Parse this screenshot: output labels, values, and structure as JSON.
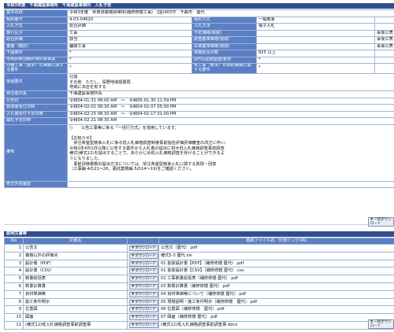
{
  "header": {
    "title": "令和3年度　千曲建設事務所　千曲建設事務所　入札予定"
  },
  "info": {
    "rows": [
      {
        "l1": "案件名称",
        "v1": "令和3年度　県単道路橋梁維持(補修修繕工事)　(国)403号　千曲市　屋代",
        "full": true
      },
      {
        "l1": "契約番号",
        "v1": "4-03-04620",
        "l2": "契約方式",
        "v2": "一般競争"
      },
      {
        "l1": "入札方式",
        "v1": "総合評価",
        "l2": "入札方法",
        "v2": "電子入札"
      },
      {
        "l1": "施行区分",
        "v1": "工事",
        "l2": "予定価格(税抜)",
        "v2": "",
        "v3": "事後公表"
      },
      {
        "l1": "総合評価",
        "v1": "該当",
        "l2": "調査基準価格(税抜)",
        "v2": "",
        "v3": "事後公表"
      },
      {
        "l1": "業種（種別）",
        "v1": "舗装工事",
        "l2": "失格基準価格(税抜)",
        "v2": "",
        "v3": "事後公表"
      },
      {
        "l1": "下請要件",
        "v1": "*",
        "l2": "資格総合点数",
        "v2": "825 以上"
      },
      {
        "l1": "地域貢献活動評価対象事業",
        "v1": "*",
        "l2": "WTO(政府調達)条件",
        "v2": "*"
      },
      {
        "l1": "同種工事（要求）の実績に関する要件",
        "v1": "*",
        "l2": "県工事（要求）の契約実績に関する要件",
        "v2": "*"
      },
      {
        "l1": "地域要件",
        "v1": "北信\nその他　ただし、長野地域振興局\n地域に本店を有する",
        "full": true,
        "tall": true
      },
      {
        "l1": "発注者の長",
        "v1": "千曲建設事務所長",
        "full": true
      },
      {
        "l1": "公告日",
        "v1": "令和04-01-31 08:00 AM　～　令和05-01-30 11:59 PM",
        "full": true
      },
      {
        "l1": "質問書受付日時",
        "v1": "令和04-02-01 08:30 AM　～　令和04-02-07 05:00 PM",
        "full": true
      },
      {
        "l1": "入札書受付予定日時",
        "v1": "令和04-02-15 08:30 AM　～　令和04-02-17 01:00 PM",
        "full": true
      },
      {
        "l1": "開札予定日時",
        "v1": "令和04-02-21 08:30 AM",
        "full": true
      },
      {
        "l1": "備考",
        "v1": "○　　公告工事等に係る「一括行方式」を適用しています。\n\n【お知らせ】\n　受注希望型競争入札に係る低入札価格調査制度事前指名評価評価審査の改正に伴い、\n令和2年4月1日以降に公告する案件から入札書の提出に併せ低入札価格調査事前調査\n様式(様式12)を提出することで、あらかじめ低入札価格調査を受けることができるよ\nうになりました。\n　事前評価書類の提出方法については、受注希望型競争入札に関する質問・回答\n（工事編-4の21～26、委託業務編-5の14～19)をご確認ください。",
        "full": true,
        "huge": true
      },
      {
        "l1": "修正内容履歴",
        "v1": "",
        "full": true
      }
    ]
  },
  "buttons": {
    "download_all": "一括ダウンロード",
    "download": "ダウンロード"
  },
  "files": {
    "section_title": "説明文書等",
    "headers": {
      "no": "No",
      "name": "文書名",
      "file": "格納ファイル名／外部リンクURL"
    },
    "rows": [
      {
        "no": "1",
        "name": "公告文",
        "file": "公告文（屋代）.pdf"
      },
      {
        "no": "2",
        "name": "価格以外の評価点",
        "file": "様式5-3 屋代.xls"
      },
      {
        "no": "3",
        "name": "設計書（PDF）",
        "file": "01 金抜設計書【PDF】（補修修繕 屋代）.pdf"
      },
      {
        "no": "4",
        "name": "設計書（CSV）",
        "file": "01 金抜設計書【CSV】（補修修繕 屋代）.csv"
      },
      {
        "no": "5",
        "name": "数量総括表",
        "file": "02 工事数量総括表（補修修繕 屋代）.pdf"
      },
      {
        "no": "6",
        "name": "数量計算書",
        "file": "03 数量計算書（補修修繕 屋代）.pdf"
      },
      {
        "no": "7",
        "name": "資材単価等",
        "file": "04 資材単価等について（補修修繕 屋代）.pdf"
      },
      {
        "no": "8",
        "name": "施工条件明示",
        "file": "05 現場説明・施工条件明示（補修修繕　屋代）.pdf"
      },
      {
        "no": "9",
        "name": "位置図",
        "file": "06 位置図（補修修繕　屋代）.pdf"
      },
      {
        "no": "10",
        "name": "図面",
        "file": "07 図面（補修修繕 屋代）.pdf"
      },
      {
        "no": "11",
        "name": "(様式12)低入札価格調査事前調査票",
        "file": "(様式12)低入札価格調査事前調査票.docx"
      }
    ]
  }
}
